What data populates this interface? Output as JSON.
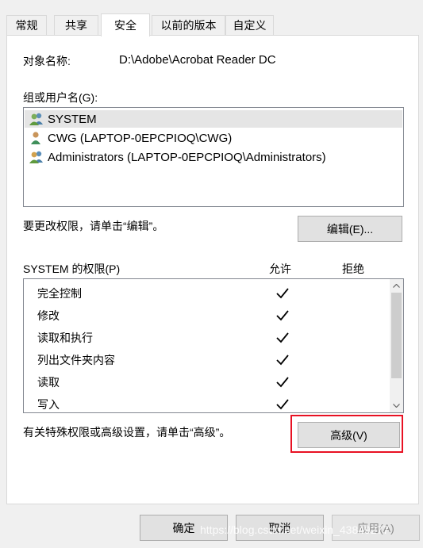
{
  "tabs": [
    "常规",
    "共享",
    "安全",
    "以前的版本",
    "自定义"
  ],
  "object_label": "对象名称:",
  "object_path": "D:\\Adobe\\Acrobat Reader DC",
  "groups_label": "组或用户名(G):",
  "groups": [
    {
      "name": "SYSTEM",
      "icon": "users-group-icon"
    },
    {
      "name": "CWG (LAPTOP-0EPCPIOQ\\CWG)",
      "icon": "user-icon"
    },
    {
      "name": "Administrators (LAPTOP-0EPCPIOQ\\Administrators)",
      "icon": "users-group-icon"
    }
  ],
  "edit_hint": "要更改权限，请单击“编辑”。",
  "edit_button": "编辑(E)...",
  "perm_label": "SYSTEM 的权限(P)",
  "allow_header": "允许",
  "deny_header": "拒绝",
  "permissions": [
    {
      "name": "完全控制",
      "allow": true,
      "deny": false
    },
    {
      "name": "修改",
      "allow": true,
      "deny": false
    },
    {
      "name": "读取和执行",
      "allow": true,
      "deny": false
    },
    {
      "name": "列出文件夹内容",
      "allow": true,
      "deny": false
    },
    {
      "name": "读取",
      "allow": true,
      "deny": false
    },
    {
      "name": "写入",
      "allow": true,
      "deny": false
    }
  ],
  "advanced_hint": "有关特殊权限或高级设置，请单击“高级”。",
  "advanced_button": "高级(V)",
  "footer": {
    "ok": "确定",
    "cancel": "取消",
    "apply": "应用(A)"
  },
  "watermark": "https://blog.csdn.net/weixin_43849277",
  "colors": {
    "highlight_box": "#e81123"
  }
}
